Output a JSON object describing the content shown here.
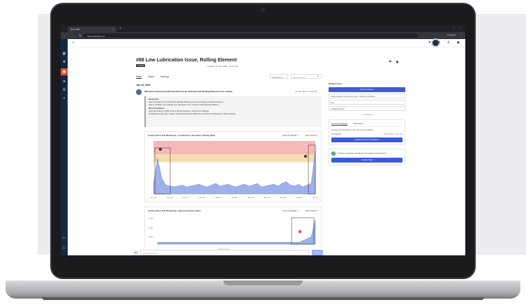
{
  "browser": {
    "tab_title": "Issue #88",
    "new_tab": "+",
    "window_controls": "– □ ×",
    "nav": "← → ↻",
    "url": "https://tractian.com",
    "incognito": "Incognito"
  },
  "app": {
    "left_nav_icons": [
      "grid-icon",
      "plus-icon",
      "issues-icon",
      "star-icon",
      "gear-icon",
      "location-icon"
    ],
    "left_nav_bottom": [
      "chat-icon",
      "help-icon"
    ],
    "topbar_icons": "♥ ★ ♙ ◉"
  },
  "issue": {
    "title": "#88 Low Lubrication Issue, Rolling Element",
    "badge": "Closed",
    "created": "Created: 15 Jan 2022 · 11:21 AM"
  },
  "tabs": {
    "items": [
      "Feed",
      "Tasks",
      "Settings"
    ],
    "selected": "Feed"
  },
  "toolbar": {
    "filter": "All Activity ▾",
    "search_placeholder": "Search Feed"
  },
  "feed": {
    "date": "Jan 15, 2022",
    "post": {
      "title": "#88 Severe Bearing Fault/Lubrication Issue, Bearing Fault Rolling Element Issue created",
      "time": "15 Jan 2022 · 11:21 AM",
      "lines": [
        "Description",
        "High G-Reading in the Drive End (Rolling) Bearing (Gear box) showing an abnormal trend.",
        "High G readings may indicate poor lubrication, dry running or rolling element defects.",
        "Recommendation",
        "Lubricate bearing, if able to do so during operation, verify the G readings.",
        "If readings remain high, replace bearing (Sampling to Machine) and check for damage on rolling element."
      ]
    },
    "charts": [
      {
        "title": "Gearbox Drive End DE Bearing · Acceleration Lubrication / Bearing Wear",
        "link1": "View Per Details ↗",
        "link2": "View Trends ↗"
      },
      {
        "title": "Gearbox Drive End DE Bearing · High Acceleration Alarm",
        "link1": "View Per Details ↗",
        "link2": "View Trends ↗"
      }
    ],
    "show_more": "Show more",
    "comment_avatar": "ML",
    "comment_placeholder": "Add a comment...",
    "send_label": "Send"
  },
  "side": {
    "label": "Related Notes",
    "primary_btn": "Request Issue",
    "fields": [
      "Assign/Gearbox Lubrication Issue · Bearing Lubrication",
      "Due",
      "+ Related Events"
    ],
    "add_link": "+ Add Event",
    "card_tabs": [
      "Recommendations",
      "Resolution"
    ],
    "card_tab_selected": "Recommendations",
    "card_text": "Provide your technician 2 with new recommendation",
    "user_row": "Lily Johnson",
    "user_time": "15 Jan 2022 · 11:21 PM",
    "update_btn": "Update Recommendation",
    "question": "Is there a work item needed for the above for this issue?",
    "create_btn": "Create Task"
  },
  "chart_data": [
    {
      "type": "area",
      "title": "Gearbox Drive End DE Bearing · Acceleration Lubrication / Bearing Wear",
      "x": [
        "Nov 03",
        "Nov 10",
        "Nov 17",
        "Nov 24",
        "Dec 01",
        "Dec 08",
        "Dec 15",
        "Dec 22",
        "Dec 29",
        "Jan 05",
        "Jan 12"
      ],
      "ylim": [
        0,
        60
      ],
      "bands": [
        {
          "label": "alert",
          "color": "#f6b8b8",
          "from": 45,
          "to": 60
        },
        {
          "label": "warning",
          "color": "#f7dcae",
          "from": 36,
          "to": 45
        }
      ],
      "series": [
        {
          "values": [
            12,
            40,
            18,
            10,
            9,
            8,
            9,
            10,
            8,
            9,
            10,
            11,
            9,
            8,
            10,
            12,
            9,
            10,
            11,
            9,
            8,
            10,
            11,
            9,
            10,
            12,
            8,
            9,
            10,
            11,
            9,
            12,
            14,
            10,
            9,
            11,
            8,
            10,
            12,
            48
          ]
        }
      ],
      "markers": [
        "1",
        "2"
      ]
    },
    {
      "type": "area",
      "title": "Gearbox Drive End DE Bearing · High Acceleration Alarm",
      "y_ticks": [
        "1.5000",
        "1.0000",
        "0.5000"
      ],
      "series": [
        {
          "values": [
            0.1,
            0.1,
            0.1,
            0.1,
            0.1,
            0.1,
            0.1,
            0.1,
            0.1,
            0.1,
            0.1,
            0.1,
            0.1,
            0.1,
            0.1,
            0.1,
            0.1,
            0.1,
            0.1,
            0.1,
            0.1,
            0.1,
            0.1,
            0.1,
            0.1,
            0.1,
            0.1,
            0.1,
            0.1,
            0.1,
            0.1,
            0.1,
            0.1,
            0.1,
            0.1,
            0.1,
            0.2,
            0.3,
            0.4,
            1.3
          ]
        }
      ],
      "markers": [
        "1"
      ]
    }
  ]
}
